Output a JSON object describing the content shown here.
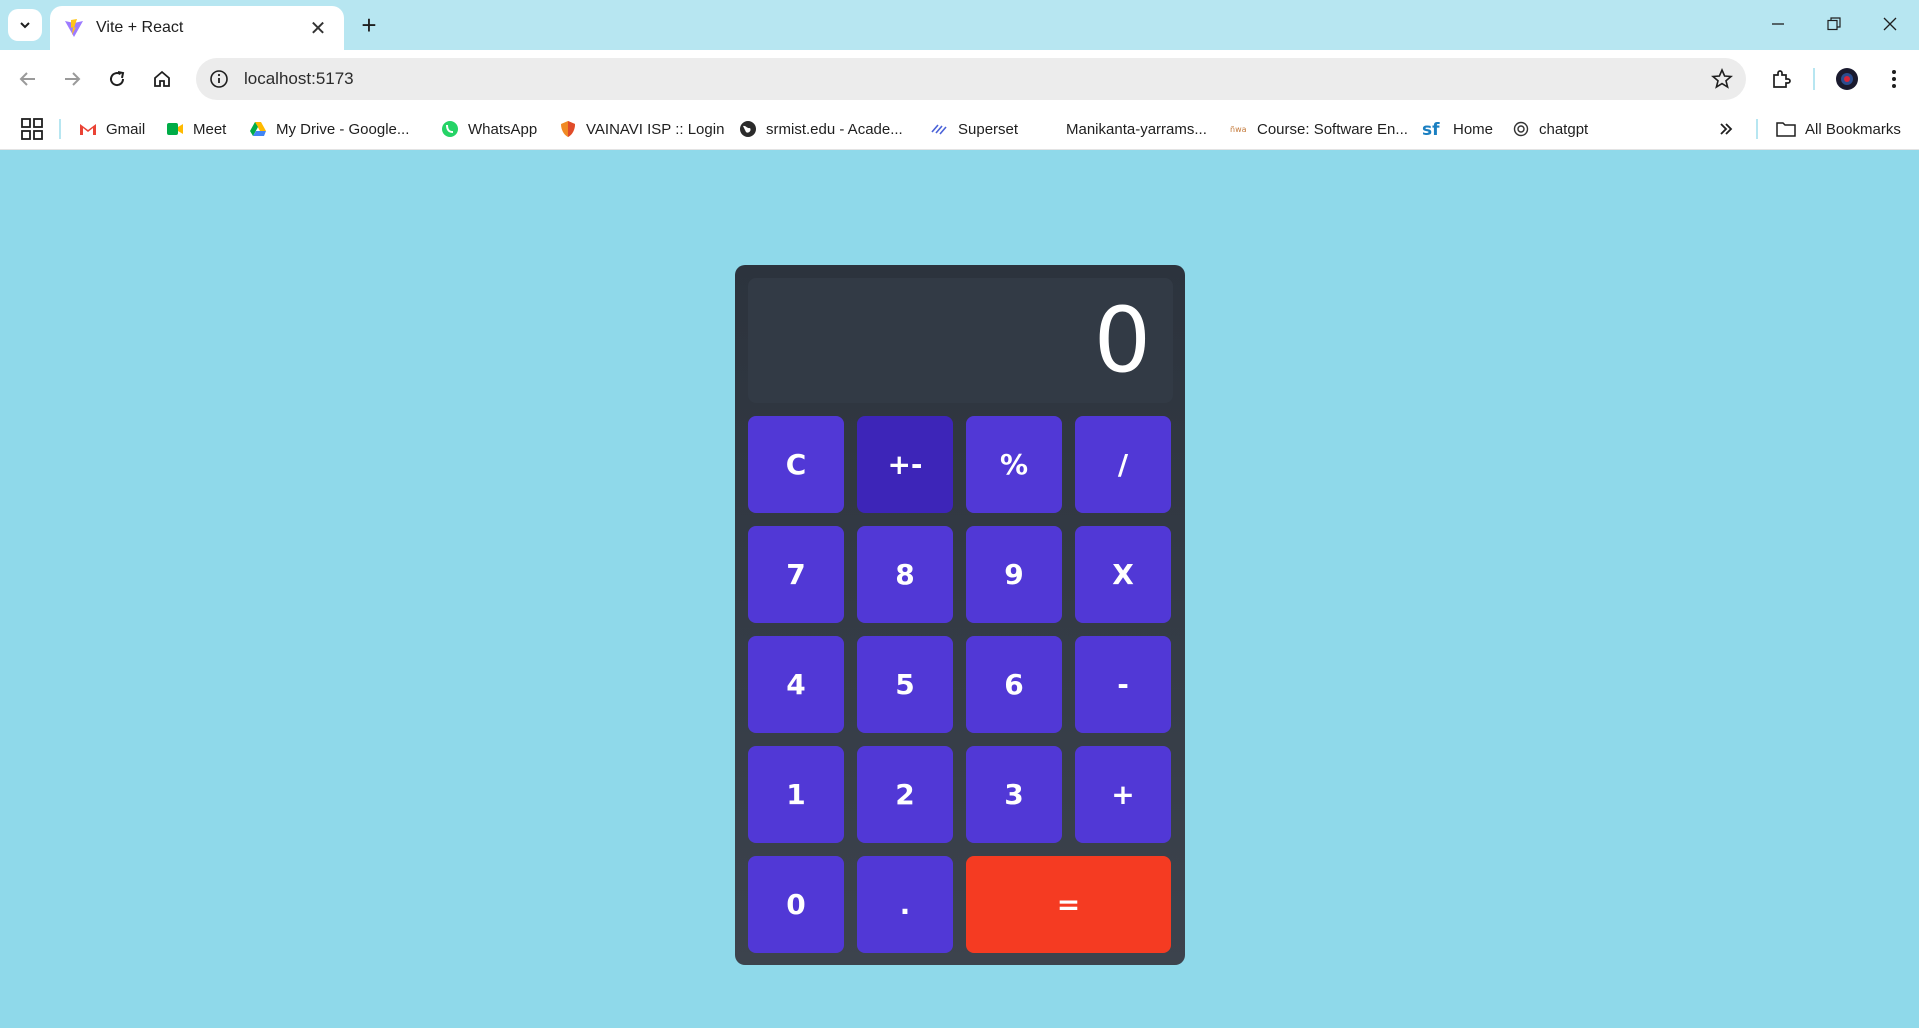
{
  "browser": {
    "tab_title": "Vite + React",
    "url": "localhost:5173",
    "bookmarks": [
      {
        "label": "Gmail",
        "icon": "gmail-icon"
      },
      {
        "label": "Meet",
        "icon": "meet-icon"
      },
      {
        "label": "My Drive - Google...",
        "icon": "drive-icon"
      },
      {
        "label": "WhatsApp",
        "icon": "whatsapp-icon"
      },
      {
        "label": "VAINAVI ISP :: Login",
        "icon": "shield-icon"
      },
      {
        "label": "srmist.edu - Acade...",
        "icon": "globe-icon"
      },
      {
        "label": "Superset",
        "icon": "superset-icon"
      },
      {
        "label": "Manikanta-yarrams...",
        "icon": "blank-icon"
      },
      {
        "label": "Course: Software En...",
        "icon": "course-icon"
      },
      {
        "label": "Home",
        "icon": "sf-icon"
      },
      {
        "label": "chatgpt",
        "icon": "openai-icon"
      }
    ],
    "all_bookmarks_label": "All Bookmarks"
  },
  "calculator": {
    "display": "0",
    "keys": [
      "C",
      "+-",
      "%",
      "/",
      "7",
      "8",
      "9",
      "X",
      "4",
      "5",
      "6",
      "-",
      "1",
      "2",
      "3",
      "+",
      "0",
      ".",
      "="
    ],
    "colors": {
      "key": "#5138d6",
      "key_active": "#3d25b8",
      "equals": "#f53b22",
      "body": "#2f3640",
      "page_bg": "#8fd9ea"
    }
  }
}
